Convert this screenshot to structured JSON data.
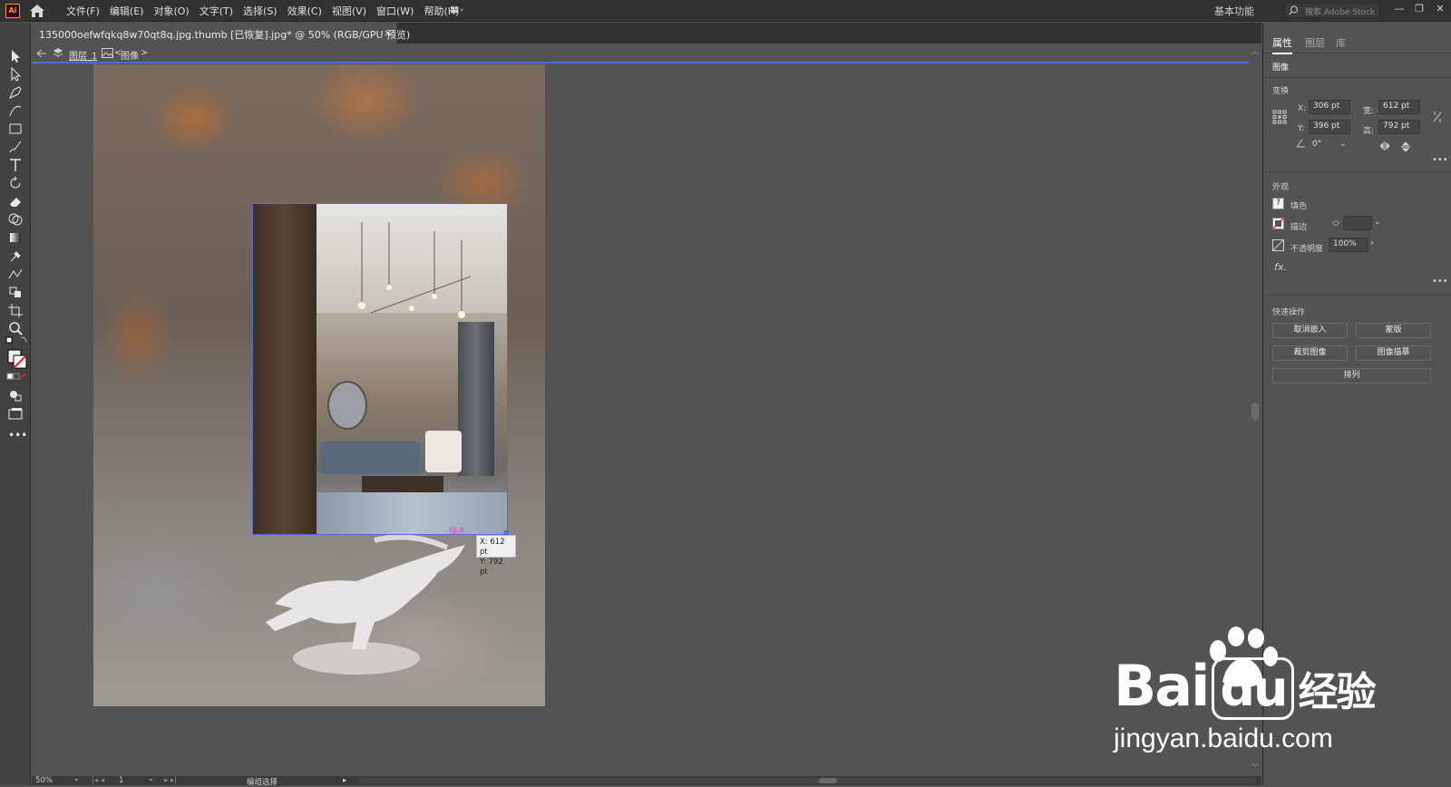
{
  "app": {
    "logo": "Ai"
  },
  "menu": {
    "items": [
      "文件(F)",
      "编辑(E)",
      "对象(O)",
      "文字(T)",
      "选择(S)",
      "效果(C)",
      "视图(V)",
      "窗口(W)",
      "帮助(H)"
    ],
    "workspace": "基本功能",
    "search_placeholder": "搜索 Adobe Stock"
  },
  "document": {
    "tab_title": "135000oefwfqkq8w70qt8q.jpg.thumb [已恢复].jpg* @ 50% (RGB/GPU 预览)",
    "close": "×"
  },
  "isolation": {
    "layer": "图层_1",
    "object": "图像"
  },
  "canvas": {
    "anchor_label": "锚点",
    "coord_x": "X: 612 pt",
    "coord_y": "Y: 792 pt"
  },
  "status": {
    "zoom": "50%",
    "page": "1",
    "mode": "编组选择"
  },
  "panel": {
    "tabs": [
      "属性",
      "图层",
      "库"
    ],
    "object_type": "图像",
    "transform": {
      "title": "变换",
      "x_label": "X:",
      "x": "306 pt",
      "y_label": "Y:",
      "y": "396 pt",
      "w_label": "宽:",
      "w": "612 pt",
      "h_label": "高:",
      "h": "792 pt",
      "angle": "0°"
    },
    "appearance": {
      "title": "外观",
      "fill_label": "填色",
      "stroke_label": "描边",
      "opacity_label": "不透明度",
      "opacity": "100%",
      "fx": "fx."
    },
    "quick_actions": {
      "title": "快速操作",
      "unembed": "取消嵌入",
      "mask": "蒙版",
      "crop": "裁剪图像",
      "trace": "图像描摹",
      "arrange": "排列"
    }
  },
  "watermark": {
    "brand": "Bai",
    "brand_cn": "经验",
    "site": "jingyan.baidu.com"
  },
  "colors": {
    "selection_blue": "#4a6fd8",
    "anchor_magenta": "#e040e0",
    "ai_orange": "#ff9a00"
  }
}
